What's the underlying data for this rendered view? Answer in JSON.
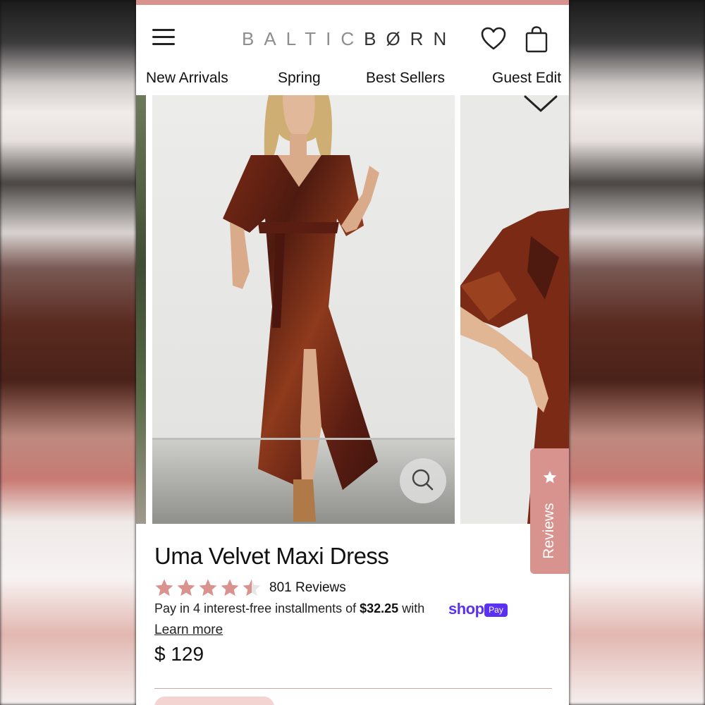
{
  "brand": {
    "logo_part1": "BALTIC",
    "logo_part2": "BØRN",
    "accent_color": "#d9938f"
  },
  "header": {
    "menu_icon": "hamburger-menu-icon",
    "wishlist_icon": "heart-icon",
    "cart_icon": "shopping-bag-icon"
  },
  "nav": {
    "items": [
      {
        "label": "New Arrivals"
      },
      {
        "label": "Spring"
      },
      {
        "label": "Best Sellers"
      },
      {
        "label": "Guest Edit"
      }
    ]
  },
  "gallery": {
    "zoom_icon": "magnifier-icon",
    "wishlist_icon": "heart-outline-icon"
  },
  "reviews_tab": {
    "label": "Reviews",
    "icon": "star-icon"
  },
  "product": {
    "title": "Uma Velvet Maxi Dress",
    "rating": 4.5,
    "rating_max": 5,
    "review_count_label": "801 Reviews",
    "installment_text_pre": "Pay in 4 interest-free installments of ",
    "installment_amount": "$32.25",
    "installment_text_post": " with ",
    "shop_logo": "shop",
    "pay_badge": "Pay",
    "learn_more": "Learn more",
    "price": "$ 129",
    "star_color": "#d9938f"
  }
}
